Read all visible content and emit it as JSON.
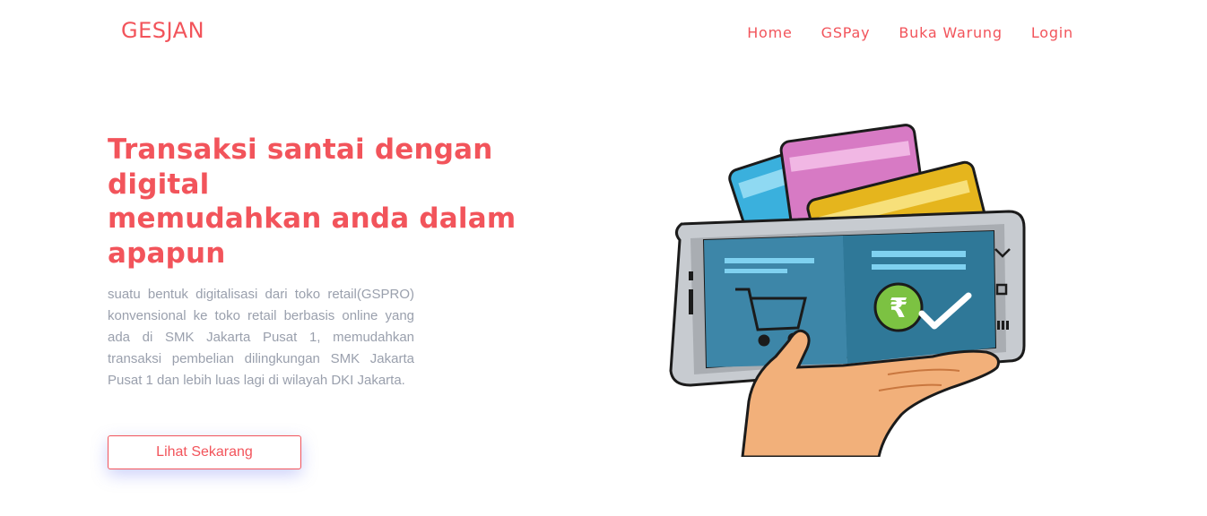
{
  "navbar": {
    "brand": "GESJAN",
    "links": [
      {
        "label": "Home"
      },
      {
        "label": "GSPay"
      },
      {
        "label": "Buka Warung"
      },
      {
        "label": "Login"
      }
    ]
  },
  "hero": {
    "title_line1": "Transaksi santai dengan digital",
    "title_line2": "memudahkan anda dalam apapun",
    "description": "suatu bentuk digitalisasi dari toko retail(GSPRO) konvensional ke toko retail berbasis online yang ada di SMK Jakarta Pusat 1, memudahkan transaksi pembelian dilingkungan SMK Jakarta Pusat 1 dan lebih luas lagi di wilayah DKI Jakarta.",
    "cta_label": "Lihat Sekarang"
  },
  "illustration": {
    "currency_symbol": "₹"
  },
  "colors": {
    "accent": "#f2545b",
    "muted_text": "#9aa0ad"
  }
}
